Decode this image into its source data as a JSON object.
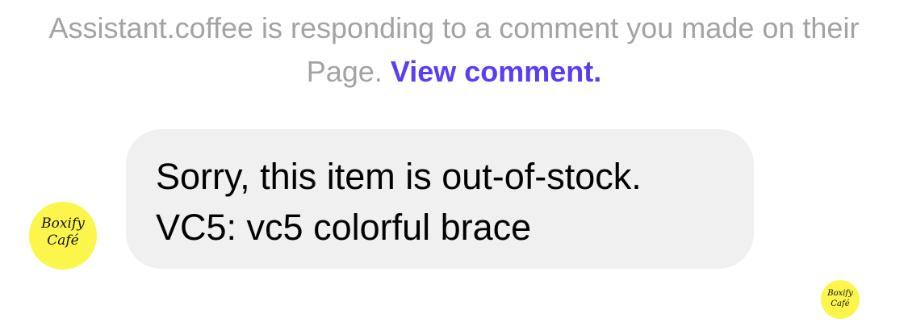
{
  "notice": {
    "text": "Assistant.coffee is responding to a comment you made on their Page.",
    "link_label": "View comment.",
    "link_color": "#5b3df5",
    "text_color": "#a3a3a3"
  },
  "message": {
    "line1": "Sorry, this item is out-of-stock.",
    "line2": "VC5: vc5 colorful brace",
    "bubble_color": "#f0f0f0"
  },
  "avatar": {
    "line1": "Boxify",
    "line2": "Café",
    "color": "#fcf64c"
  },
  "read_receipt": {
    "line1": "Boxify",
    "line2": "Café"
  }
}
